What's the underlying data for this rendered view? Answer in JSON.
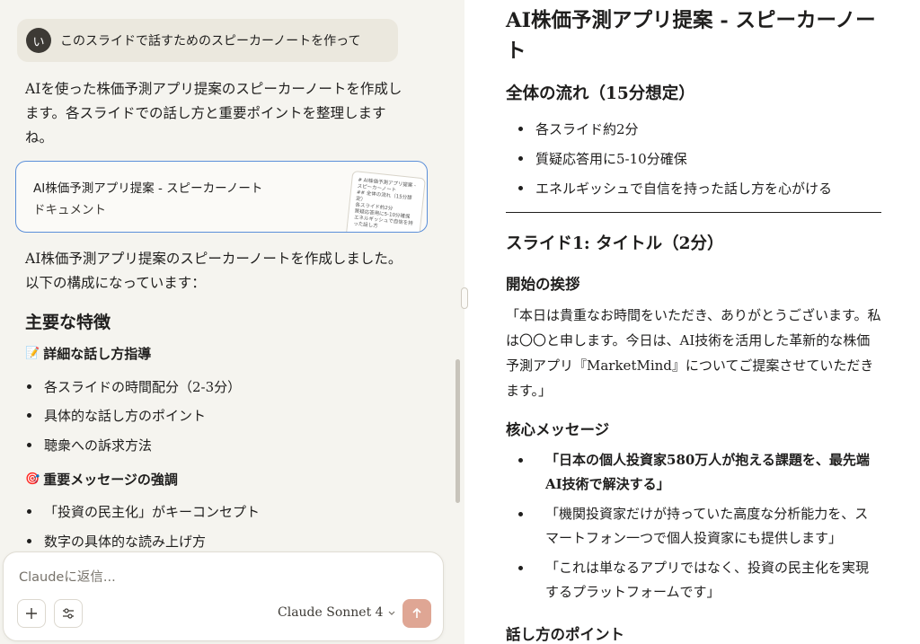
{
  "chat": {
    "user_avatar": "い",
    "user_message": "このスライドで話すためのスピーカーノートを作って",
    "intro": "AIを使った株価予測アプリ提案のスピーカーノートを作成します。各スライドでの話し方と重要ポイントを整理しますね。",
    "artifact": {
      "title": "AI株価予測アプリ提案 - スピーカーノート",
      "type": "ドキュメント",
      "thumb_lines": [
        "# AI株価予測アプリ提案 - スピーカーノート",
        "## 全体の流れ（15分想定）",
        "各スライド約2分",
        "質疑応答用に5-10分確保",
        "エネルギッシュで自信を持った話し方"
      ]
    },
    "summary": "AI株価予測アプリ提案のスピーカーノートを作成しました。以下の構成になっています：",
    "features_heading": "主要な特徴",
    "feature1": {
      "emoji": "📝",
      "title": "詳細な話し方指導",
      "items": [
        "各スライドの時間配分（2-3分）",
        "具体的な話し方のポイント",
        "聴衆への訴求方法"
      ]
    },
    "feature2": {
      "emoji": "🎯",
      "title": "重要メッセージの強調",
      "items": [
        "「投資の民主化」がキーコンセプト",
        "数字の具体的な読み上げ方"
      ]
    }
  },
  "composer": {
    "placeholder": "Claudeに返信...",
    "add_icon": "plus-icon",
    "tools_icon": "sliders-icon",
    "model": "Claude Sonnet 4",
    "send_icon": "arrow-up-icon",
    "send_color": "#dfa694"
  },
  "document": {
    "title": "AI株価予測アプリ提案 - スピーカーノート",
    "flow_heading": "全体の流れ（15分想定）",
    "flow_items": [
      "各スライド約2分",
      "質疑応答用に5-10分確保",
      "エネルギッシュで自信を持った話し方を心がける"
    ],
    "slide1_heading": "スライド1: タイトル（2分）",
    "greeting_heading": "開始の挨拶",
    "greeting_text": "「本日は貴重なお時間をいただき、ありがとうございます。私は〇〇と申します。今日は、AI技術を活用した革新的な株価予測アプリ『MarketMind』についてご提案させていただきます。」",
    "core_heading": "核心メッセージ",
    "core_items": [
      "「日本の個人投資家580万人が抱える課題を、最先端AI技術で解決する」",
      "「機関投資家だけが持っていた高度な分析能力を、スマートフォン一つで個人投資家にも提供します」",
      "「これは単なるアプリではなく、投資の民主化を実現するプラットフォームです」"
    ],
    "tips_heading": "話し方のポイント"
  },
  "colors": {
    "left_bg": "#f5f4ef",
    "artifact_border": "#5b8fd9",
    "user_bubble": "#ebe8de"
  }
}
